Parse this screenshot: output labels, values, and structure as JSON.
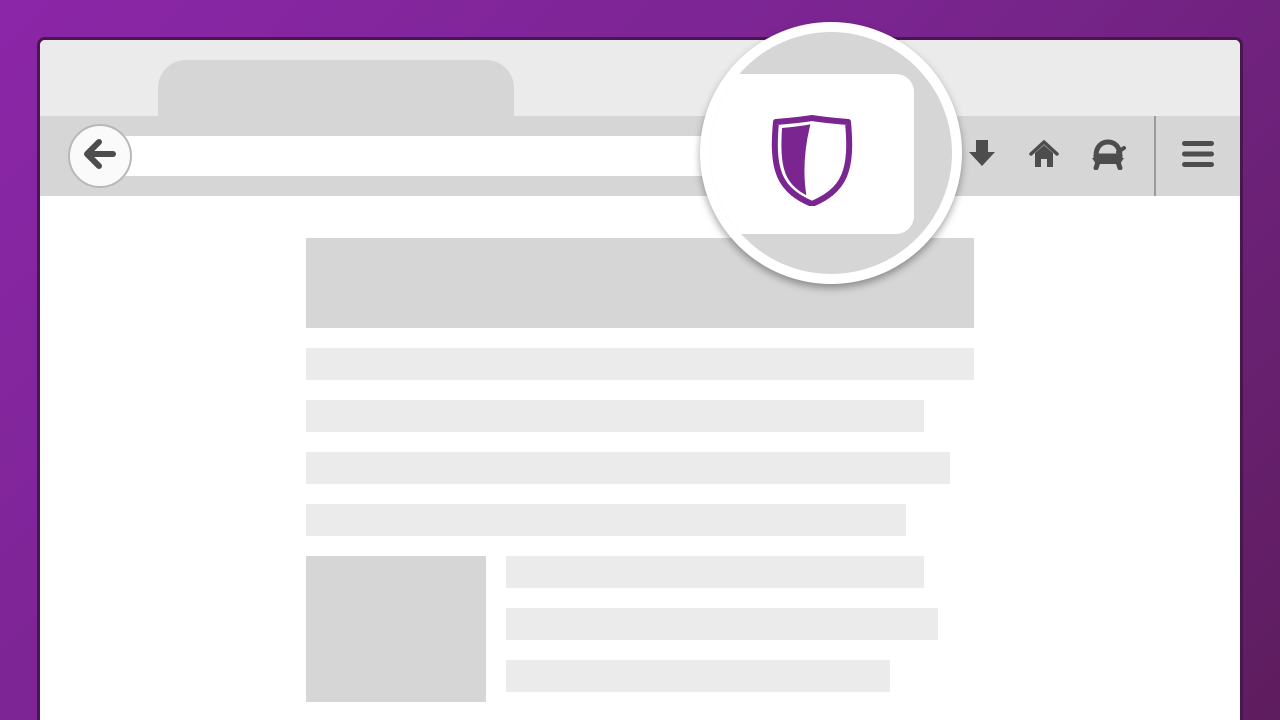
{
  "theme": {
    "background_gradient": [
      "#8b26a8",
      "#5e1d5e"
    ],
    "accent": "#7b2590",
    "icon_color": "#4d4d4d"
  },
  "tabstrip": {
    "tabs": [
      {
        "label": "",
        "active": true
      }
    ]
  },
  "toolbar": {
    "back_button": {
      "icon": "back-arrow-icon"
    },
    "url": {
      "value": "",
      "placeholder": ""
    },
    "icons": [
      "download-icon",
      "home-icon",
      "sync-turtle-icon",
      "hamburger-menu-icon"
    ]
  },
  "magnifier": {
    "icon": "tracking-protection-shield-icon"
  },
  "page": {
    "text_lines": 4,
    "side_lines": 3
  }
}
